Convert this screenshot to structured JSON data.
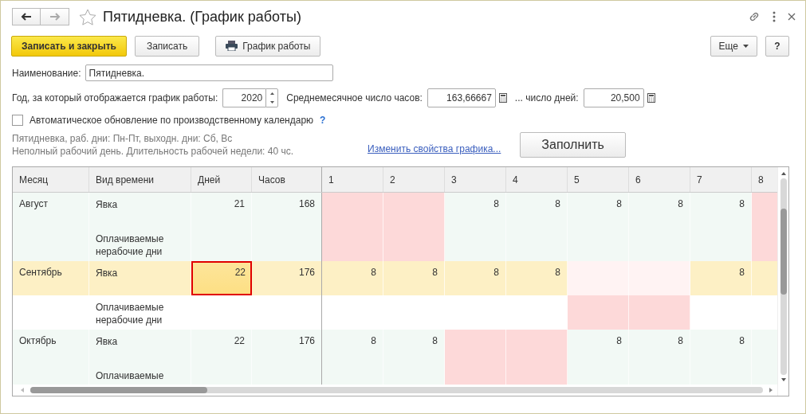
{
  "window": {
    "title": "Пятидневка. (График работы)"
  },
  "toolbar": {
    "buttons": [
      {
        "label": "Записать и закрыть",
        "kind": "primary"
      },
      {
        "label": "Записать",
        "kind": "plain"
      },
      {
        "label": "График работы",
        "kind": "print"
      }
    ],
    "more": "Еще",
    "help": "?"
  },
  "name_field": {
    "label": "Наименование:",
    "value": "Пятидневка."
  },
  "year": {
    "label": "Год, за который отображается график работы:",
    "value": "2020"
  },
  "avg_hours": {
    "label": "Среднемесячное число часов:",
    "value": "163,66667"
  },
  "avg_days": {
    "label": "... число дней:",
    "value": "20,500"
  },
  "auto_update": {
    "label": "Автоматическое обновление по производственному календарю",
    "checked": false,
    "help": "?"
  },
  "info": [
    "Пятидневка, раб. дни: Пн-Пт, выходн. дни: Сб, Вс",
    "Неполный рабочий день. Длительность рабочей недели: 40 чс."
  ],
  "change_link": "Изменить свойства графика...",
  "fill_button": "Заполнить",
  "table": {
    "columns": [
      "Месяц",
      "Вид времени",
      "Дней",
      "Часов",
      "1",
      "2",
      "3",
      "4",
      "5",
      "6",
      "7",
      "8"
    ],
    "months": [
      {
        "month": "Август",
        "rows": [
          {
            "type": "Явка",
            "days": "21",
            "hours": "168",
            "selected": false,
            "days_focused": false,
            "cells": [
              {
                "kind": "off"
              },
              {
                "kind": "off"
              },
              {
                "kind": "work",
                "value": "8"
              },
              {
                "kind": "work",
                "value": "8"
              },
              {
                "kind": "work",
                "value": "8"
              },
              {
                "kind": "work",
                "value": "8"
              },
              {
                "kind": "work",
                "value": "8"
              },
              {
                "kind": "off"
              }
            ]
          },
          {
            "type": "Оплачиваемые нерабочие дни",
            "selected": false,
            "days_focused": false,
            "cells": [
              {
                "kind": "off"
              },
              {
                "kind": "off"
              },
              {
                "kind": "work"
              },
              {
                "kind": "work"
              },
              {
                "kind": "work"
              },
              {
                "kind": "work"
              },
              {
                "kind": "work"
              },
              {
                "kind": "off"
              }
            ]
          }
        ]
      },
      {
        "month": "Сентябрь",
        "rows": [
          {
            "type": "Явка",
            "days": "22",
            "hours": "176",
            "selected": true,
            "days_focused": true,
            "cells": [
              {
                "kind": "work",
                "value": "8"
              },
              {
                "kind": "work",
                "value": "8"
              },
              {
                "kind": "work",
                "value": "8"
              },
              {
                "kind": "work",
                "value": "8"
              },
              {
                "kind": "off_light"
              },
              {
                "kind": "off_light"
              },
              {
                "kind": "work",
                "value": "8"
              },
              {
                "kind": "work"
              }
            ]
          },
          {
            "type": "Оплачиваемые нерабочие дни",
            "selected": false,
            "days_focused": false,
            "cells": [
              {
                "kind": "work"
              },
              {
                "kind": "work"
              },
              {
                "kind": "work"
              },
              {
                "kind": "work"
              },
              {
                "kind": "off"
              },
              {
                "kind": "off"
              },
              {
                "kind": "work"
              },
              {
                "kind": "work"
              }
            ]
          }
        ]
      },
      {
        "month": "Октябрь",
        "rows": [
          {
            "type": "Явка",
            "days": "22",
            "hours": "176",
            "selected": false,
            "days_focused": false,
            "cells": [
              {
                "kind": "work",
                "value": "8"
              },
              {
                "kind": "work",
                "value": "8"
              },
              {
                "kind": "off"
              },
              {
                "kind": "off"
              },
              {
                "kind": "work",
                "value": "8"
              },
              {
                "kind": "work",
                "value": "8"
              },
              {
                "kind": "work",
                "value": "8"
              },
              {
                "kind": "work"
              }
            ]
          },
          {
            "type": "Оплачиваемые",
            "selected": false,
            "days_focused": false,
            "cells": [
              {
                "kind": "work"
              },
              {
                "kind": "work"
              },
              {
                "kind": "off"
              },
              {
                "kind": "off"
              },
              {
                "kind": "work"
              },
              {
                "kind": "work"
              },
              {
                "kind": "work"
              },
              {
                "kind": "work"
              }
            ]
          }
        ]
      }
    ]
  }
}
